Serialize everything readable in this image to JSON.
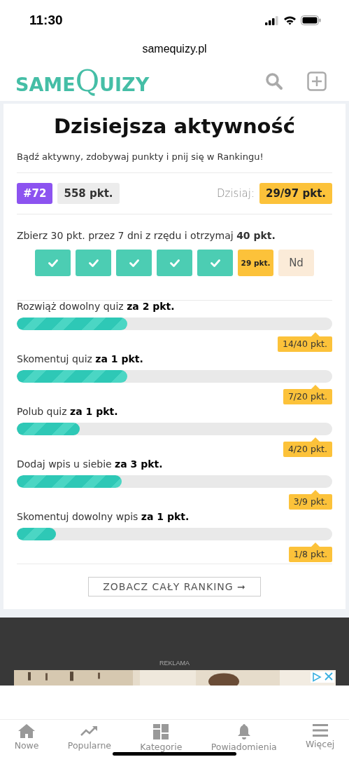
{
  "status_bar": {
    "time": "11:30"
  },
  "browser": {
    "url": "samequizy.pl"
  },
  "header": {
    "logo": "SAMEQUIZY"
  },
  "activity": {
    "title": "Dzisiejsza aktywność",
    "subtitle": "Bądź aktywny, zdobywaj punkty i pnij się w Rankingu!",
    "rank": "#72",
    "points": "558 pkt.",
    "today_label": "Dzisiaj:",
    "today_points": "29/97 pkt.",
    "streak_text": "Zbierz 30 pkt. przez 7 dni z rzędu i otrzymaj **40 pkt.**",
    "days": [
      {
        "kind": "done"
      },
      {
        "kind": "done"
      },
      {
        "kind": "done"
      },
      {
        "kind": "done"
      },
      {
        "kind": "done"
      },
      {
        "kind": "current",
        "label": "29 pkt."
      },
      {
        "kind": "future",
        "label": "Nd"
      }
    ],
    "tasks": [
      {
        "label": "Rozwiąż dowolny quiz **za 2 pkt.**",
        "level": 0.35,
        "progress": "14/40 pkt."
      },
      {
        "label": "Skomentuj quiz **za 1 pkt.**",
        "level": 0.35,
        "progress": "7/20 pkt."
      },
      {
        "label": "Polub quiz **za 1 pkt.**",
        "level": 0.2,
        "progress": "4/20 pkt."
      },
      {
        "label": "Dodaj wpis u siebie **za 3 pkt.**",
        "level": 0.333,
        "progress": "3/9 pkt."
      },
      {
        "label": "Skomentuj dowolny wpis **za 1 pkt.**",
        "level": 0.125,
        "progress": "1/8 pkt."
      }
    ],
    "ranking_button": "ZOBACZ CAŁY RANKING ➞"
  },
  "ad": {
    "label": "REKLAMA",
    "kind": "picture"
  },
  "bottom_nav": [
    {
      "kind": "home",
      "label": "Nowe"
    },
    {
      "kind": "trending",
      "label": "Popularne"
    },
    {
      "kind": "grid",
      "label": "Kategorie"
    },
    {
      "kind": "bell",
      "label": "Powiadomienia"
    },
    {
      "kind": "menu",
      "label": "Więcej"
    }
  ]
}
